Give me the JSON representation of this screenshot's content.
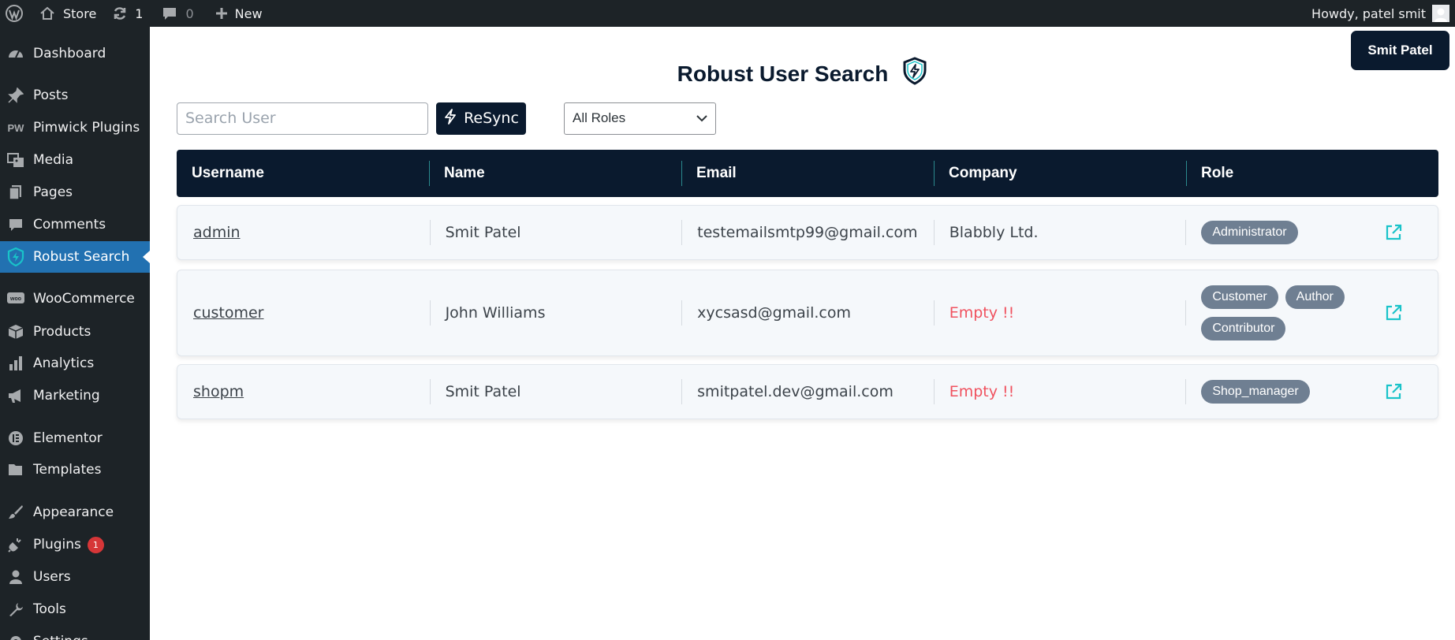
{
  "adminbar": {
    "site_name": "Store",
    "updates_count": "1",
    "comments_count": "0",
    "new_label": "New",
    "howdy": "Howdy, patel smit"
  },
  "sidebar": {
    "items": [
      {
        "label": "Dashboard",
        "icon": "dashboard-icon"
      },
      {
        "label": "Posts",
        "icon": "pin-icon"
      },
      {
        "label": "Pimwick Plugins",
        "icon": "pw-icon"
      },
      {
        "label": "Media",
        "icon": "media-icon"
      },
      {
        "label": "Pages",
        "icon": "pages-icon"
      },
      {
        "label": "Comments",
        "icon": "comment-icon"
      },
      {
        "label": "Robust Search",
        "icon": "shield-icon",
        "active": true
      },
      {
        "label": "WooCommerce",
        "icon": "woo-icon"
      },
      {
        "label": "Products",
        "icon": "box-icon"
      },
      {
        "label": "Analytics",
        "icon": "bar-chart-icon"
      },
      {
        "label": "Marketing",
        "icon": "megaphone-icon"
      },
      {
        "label": "Elementor",
        "icon": "elementor-icon"
      },
      {
        "label": "Templates",
        "icon": "folder-icon"
      },
      {
        "label": "Appearance",
        "icon": "brush-icon"
      },
      {
        "label": "Plugins",
        "icon": "plug-icon",
        "badge": "1"
      },
      {
        "label": "Users",
        "icon": "user-icon"
      },
      {
        "label": "Tools",
        "icon": "wrench-icon"
      },
      {
        "label": "Settings",
        "icon": "settings-icon"
      }
    ]
  },
  "page": {
    "user_chip": "Smit Patel",
    "title": "Robust User Search"
  },
  "toolbar": {
    "search_placeholder": "Search User",
    "resync_label": "ReSync",
    "role_filter": "All Roles"
  },
  "table": {
    "headers": [
      "Username",
      "Name",
      "Email",
      "Company",
      "Role"
    ],
    "rows": [
      {
        "username": "admin",
        "name": "Smit Patel",
        "email": "testemailsmtp99@gmail.com",
        "company": "Blabbly Ltd.",
        "company_empty": false,
        "roles": [
          "Administrator"
        ]
      },
      {
        "username": "customer",
        "name": "John Williams",
        "email": "xycsasd@gmail.com",
        "company": "Empty !!",
        "company_empty": true,
        "roles": [
          "Customer",
          "Author",
          "Contributor"
        ]
      },
      {
        "username": "shopm",
        "name": "Smit Patel",
        "email": "smitpatel.dev@gmail.com",
        "company": "Empty !!",
        "company_empty": true,
        "roles": [
          "Shop_manager"
        ]
      }
    ]
  },
  "colors": {
    "sidebar_bg": "#1d2327",
    "active_menu": "#2271b1",
    "navy": "#0a1a2e",
    "teal": "#19c3c9",
    "empty_red": "#f0525f",
    "badge_gray": "#6f7f92"
  }
}
